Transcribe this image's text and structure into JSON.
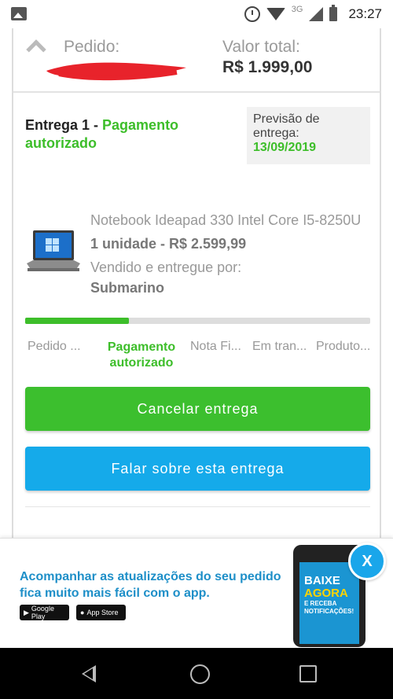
{
  "status_bar": {
    "network": "3G",
    "time": "23:27"
  },
  "summary": {
    "pedido_label": "Pedido:",
    "valor_label": "Valor total:",
    "valor_value": "R$ 1.999,00"
  },
  "entrega": {
    "title": "Entrega 1 - ",
    "status": "Pagamento autorizado",
    "previsao_label": "Previsão de entrega:",
    "previsao_date": "13/09/2019"
  },
  "product": {
    "name": "Notebook Ideapad 330 Intel Core I5-8250U",
    "quantity_price": "1 unidade - R$ 2.599,99",
    "seller_label": "Vendido e entregue por:",
    "seller": "Submarino"
  },
  "progress": {
    "value": 0.3
  },
  "steps": [
    {
      "label": "Pedido ..."
    },
    {
      "label": "Pagamento autorizado"
    },
    {
      "label": "Nota Fi..."
    },
    {
      "label": "Em tran..."
    },
    {
      "label": "Produto..."
    }
  ],
  "buttons": {
    "cancel": "Cancelar entrega",
    "falar": "Falar sobre esta entrega"
  },
  "banner": {
    "text": "Acompanhar as atualizações do seu pedido fica muito mais fácil com o app.",
    "google_play": "Google Play",
    "app_store": "App Store",
    "phone_line1": "BAIXE",
    "phone_line2": "AGORA",
    "phone_line3": "E RECEBA",
    "phone_line4": "NOTIFICAÇÕES!",
    "close": "X"
  },
  "colors": {
    "green": "#3dbe2a",
    "blue": "#15aaea"
  }
}
